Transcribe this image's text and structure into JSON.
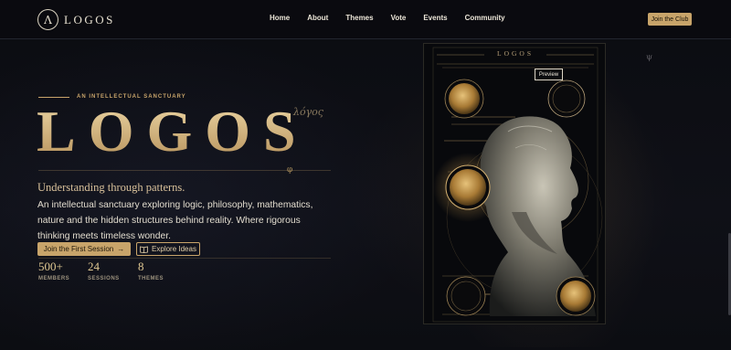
{
  "nav": {
    "logo_mark": "Λ",
    "logo_text": "LOGOS",
    "links": [
      "Home",
      "About",
      "Themes",
      "Vote",
      "Events",
      "Community"
    ],
    "cta": "Join the Club"
  },
  "hero": {
    "eyebrow": "AN INTELLECTUAL SANCTUARY",
    "title": "LOGOS",
    "greek": "λόγος",
    "phi": "φ",
    "tagline": "Understanding through patterns.",
    "description": "An intellectual sanctuary exploring logic, philosophy, mathematics, nature and the hidden structures behind reality. Where rigorous thinking meets timeless wonder.",
    "primary_button": "Join the First Session",
    "primary_icon": "→",
    "secondary_button": "Explore Ideas",
    "secondary_icon": "📖",
    "stats": [
      {
        "value": "500+",
        "label": "MEMBERS"
      },
      {
        "value": "24",
        "label": "SESSIONS"
      },
      {
        "value": "8",
        "label": "THEMES"
      }
    ]
  },
  "card": {
    "title": "LOGOS",
    "preview": "Preview"
  },
  "side_symbol": "ψ",
  "colors": {
    "accent": "#c8a46a",
    "background": "#0c0d12"
  }
}
